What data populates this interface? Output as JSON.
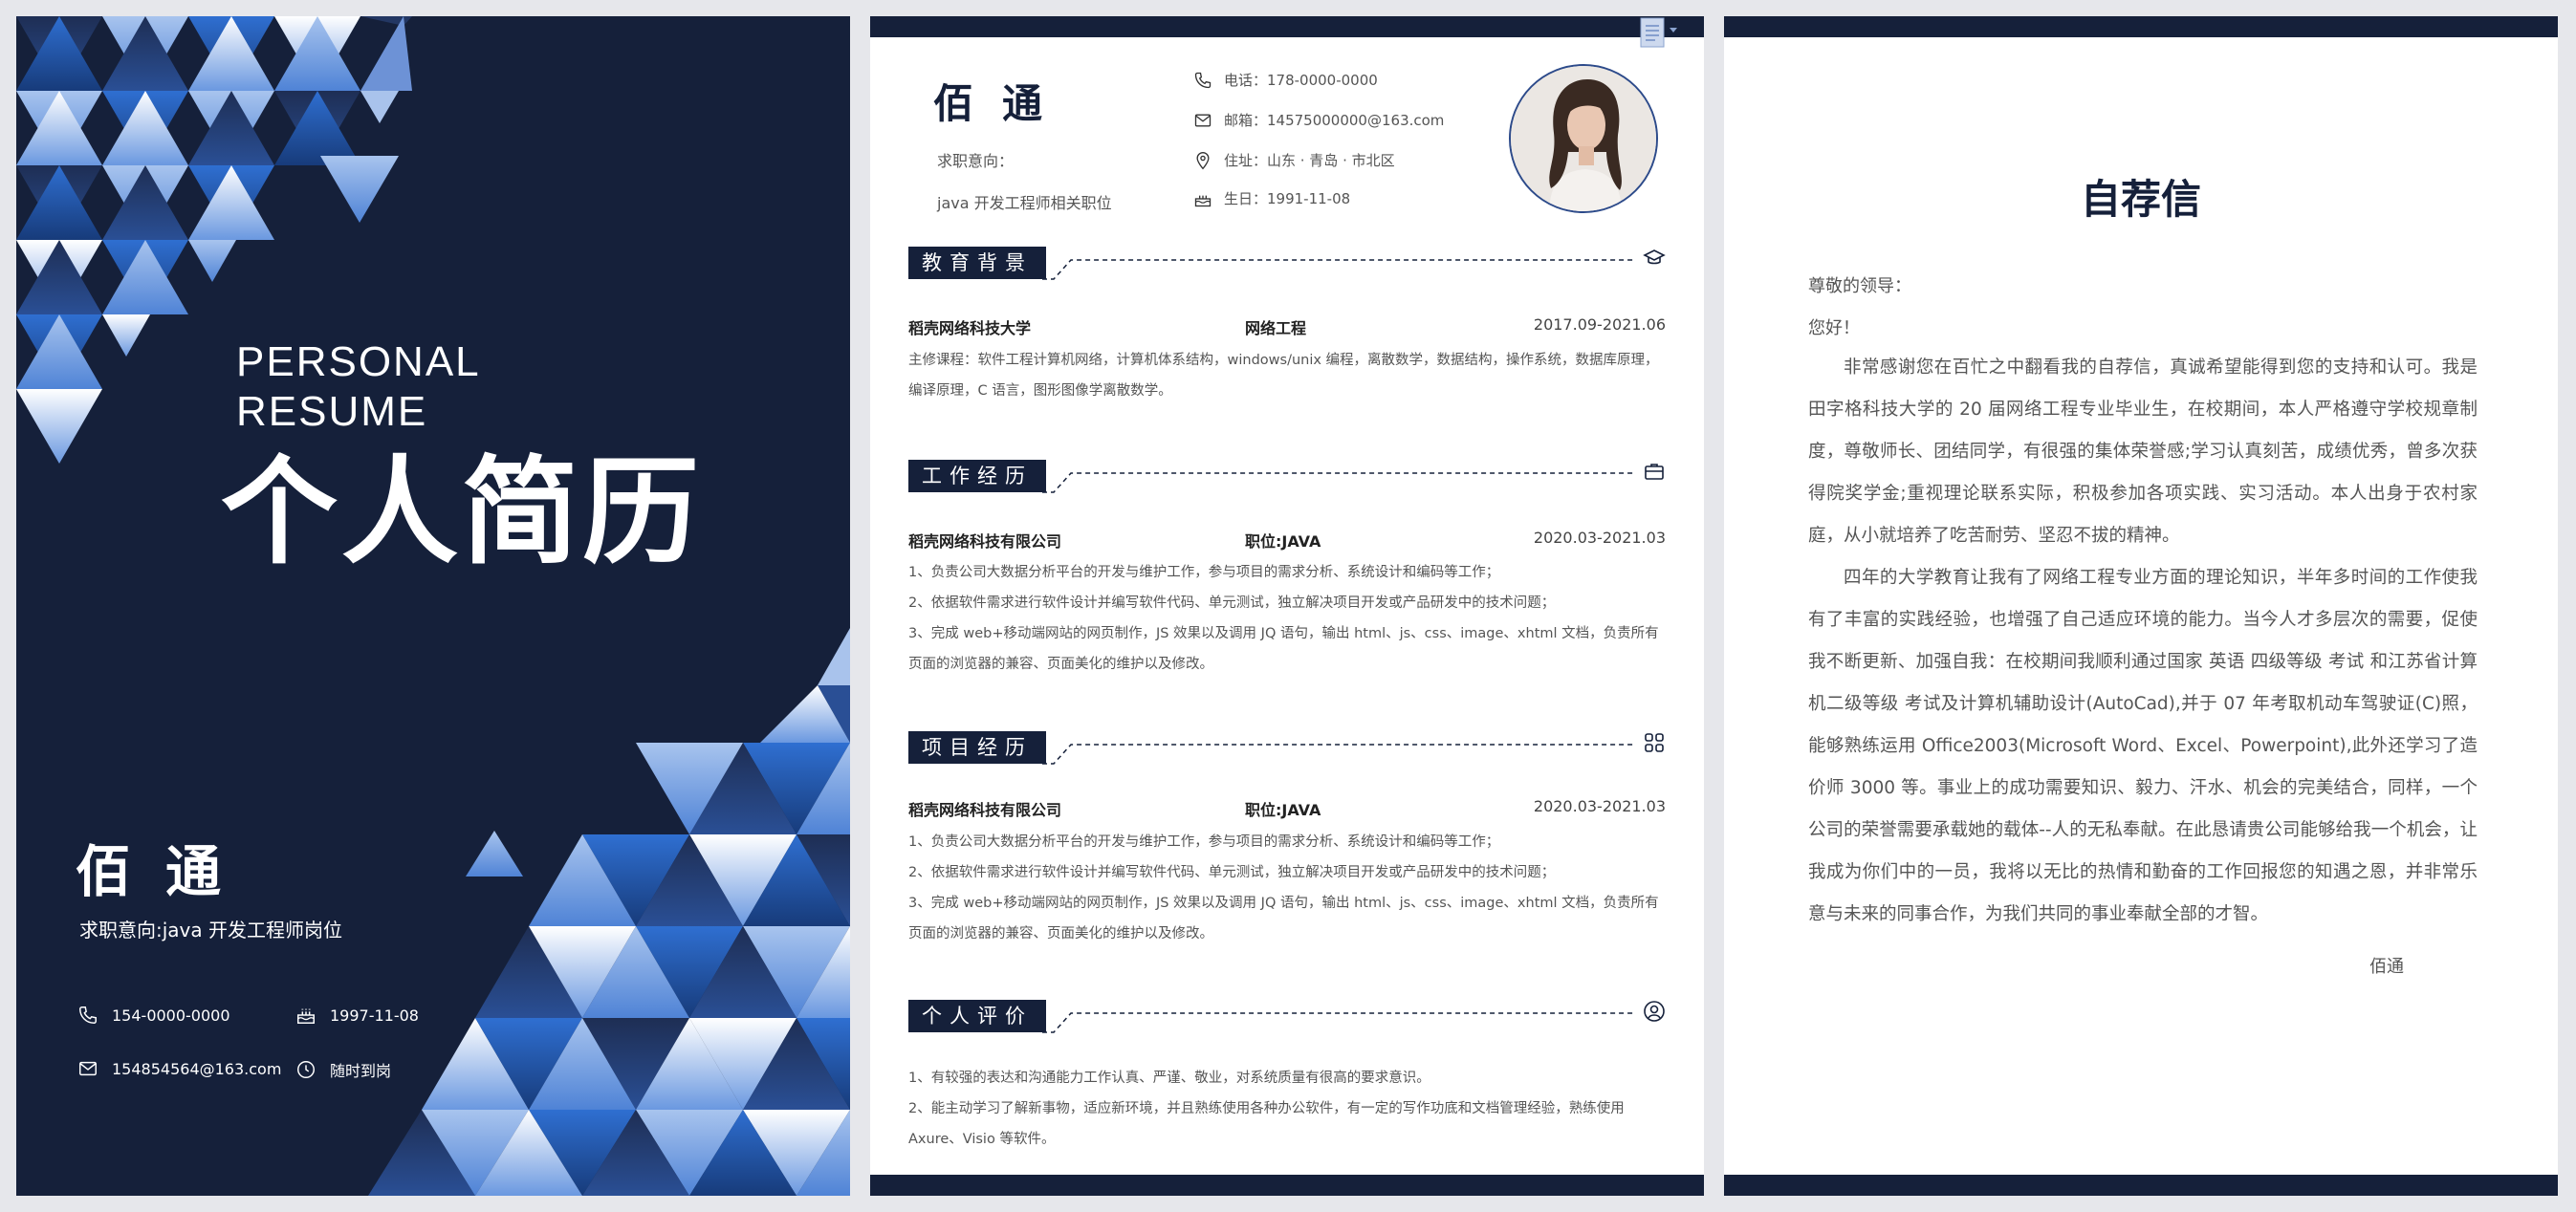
{
  "colors": {
    "navy": "#15203a",
    "accent": "#2f6fd1",
    "text": "#555555"
  },
  "cover": {
    "title_en": "PERSONAL　RESUME",
    "title_cn": "个人简历",
    "name": "佰通",
    "intent": "求职意向:java 开发工程师岗位",
    "phone": "154-0000-0000",
    "birthday": "1997-11-08",
    "email": "154854564@163.com",
    "availability": "随时到岗"
  },
  "resume": {
    "name": "佰通",
    "intent_label": "求职意向：",
    "intent": "java 开发工程师相关职位",
    "phone": "电话：178-0000-0000",
    "email": "邮箱：14575000000@163.com",
    "address": "住址：山东 · 青岛 · 市北区",
    "birthday": "生日：1991-11-08",
    "education": {
      "title": "教育背景",
      "school": "稻壳网络科技大学",
      "major": "网络工程",
      "period": "2017.09-2021.06",
      "courses": "主修课程：软件工程计算机网络，计算机体系结构，windows/unix 编程，离散数学，数据结构，操作系统，数据库原理，编译原理，C 语言，图形图像学离散数学。"
    },
    "work": {
      "title": "工作经历",
      "company": "稻壳网络科技有限公司",
      "position": "职位:JAVA",
      "period": "2020.03-2021.03",
      "items": [
        "1、负责公司大数据分析平台的开发与维护工作，参与项目的需求分析、系统设计和编码等工作；",
        "2、依据软件需求进行软件设计并编写软件代码、单元测试，独立解决项目开发或产品研发中的技术问题；",
        "3、完成 web+移动端网站的网页制作，JS 效果以及调用 JQ 语句，输出 html、js、css、image、xhtml 文档，负责所有页面的浏览器的兼容、页面美化的维护以及修改。"
      ]
    },
    "project": {
      "title": "项目经历",
      "company": "稻壳网络科技有限公司",
      "position": "职位:JAVA",
      "period": "2020.03-2021.03",
      "items": [
        "1、负责公司大数据分析平台的开发与维护工作，参与项目的需求分析、系统设计和编码等工作；",
        "2、依据软件需求进行软件设计并编写软件代码、单元测试，独立解决项目开发或产品研发中的技术问题；",
        "3、完成 web+移动端网站的网页制作，JS 效果以及调用 JQ 语句，输出 html、js、css、image、xhtml 文档，负责所有页面的浏览器的兼容、页面美化的维护以及修改。"
      ]
    },
    "evaluation": {
      "title": "个人评价",
      "items": [
        "1、有较强的表达和沟通能力工作认真、严谨、敬业，对系统质量有很高的要求意识。",
        "2、能主动学习了解新事物，适应新环境，并且熟练使用各种办公软件，有一定的写作功底和文档管理经验，熟练使用 Axure、Visio 等软件。"
      ]
    }
  },
  "letter": {
    "title": "自荐信",
    "salutation": "尊敬的领导：",
    "greeting": "您好！",
    "paragraphs": [
      "非常感谢您在百忙之中翻看我的自荐信，真诚希望能得到您的支持和认可。我是田字格科技大学的 20 届网络工程专业毕业生，在校期间，本人严格遵守学校规章制度，尊敬师长、团结同学，有很强的集体荣誉感;学习认真刻苦，成绩优秀，曾多次获得院奖学金;重视理论联系实际，积极参加各项实践、实习活动。本人出身于农村家庭，从小就培养了吃苦耐劳、坚忍不拔的精神。",
      "四年的大学教育让我有了网络工程专业方面的理论知识，半年多时间的工作使我有了丰富的实践经验，也增强了自己适应环境的能力。当今人才多层次的需要，促使我不断更新、加强自我：在校期间我顺利通过国家 英语 四级等级 考试 和江苏省计算机二级等级 考试及计算机辅助设计(AutoCad),并于 07 年考取机动车驾驶证(C)照，能够熟练运用 Office2003(Microsoft Word、Excel、Powerpoint),此外还学习了造价师 3000 等。事业上的成功需要知识、毅力、汗水、机会的完美结合，同样，一个公司的荣誉需要承载她的载体--人的无私奉献。在此恳请贵公司能够给我一个机会，让我成为你们中的一员，我将以无比的热情和勤奋的工作回报您的知遇之恩，并非常乐意与未来的同事合作，为我们共同的事业奉献全部的才智。"
    ],
    "signature": "佰通"
  }
}
